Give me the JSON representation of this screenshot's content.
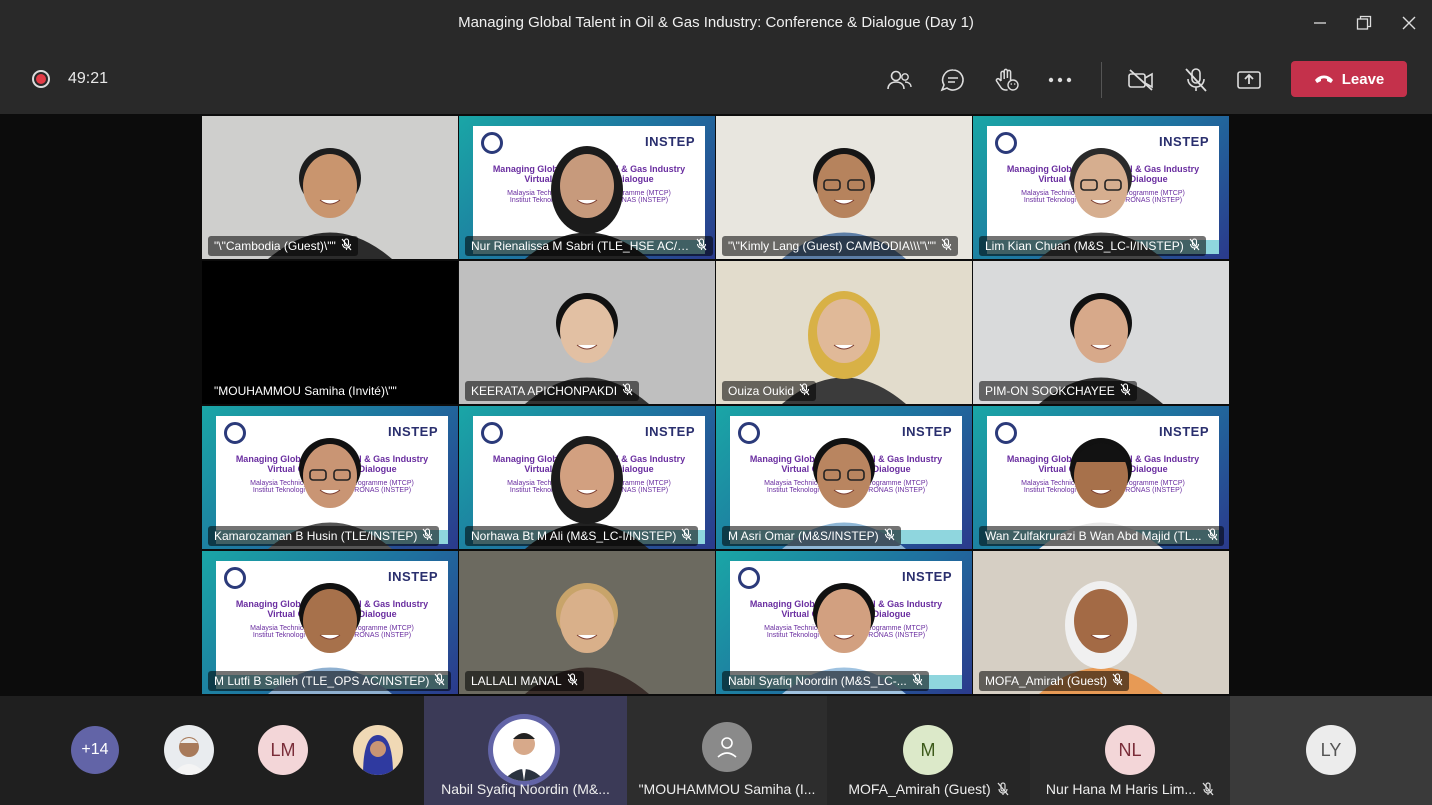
{
  "window": {
    "title": "Managing Global Talent in Oil & Gas Industry: Conference & Dialogue (Day 1)"
  },
  "toolbar": {
    "timer": "49:21",
    "leave_label": "Leave"
  },
  "slide": {
    "brand": "INSTEP",
    "line1": "Managing Global Talent in Oil & Gas Industry",
    "line1b": "Virtual Conference & Dialogue",
    "line2": "Malaysia Technical Cooperation Programme (MTCP)",
    "line2b": "Institut Teknologi Petroleum PETRONAS (INSTEP)"
  },
  "tiles": [
    {
      "name": "\"\\\"Cambodia (Guest)\\\"\""
    },
    {
      "name": "Nur Rienalissa M Sabri (TLE_HSE AC/IN..."
    },
    {
      "name": "\"\\\"Kimly Lang (Guest) CAMBODIA\\\\\\\"\\\"\""
    },
    {
      "name": "Lim Kian Chuan (M&S_LC-I/INSTEP)"
    },
    {
      "name": "\"MOUHAMMOU Samiha (Invité)\\\"\""
    },
    {
      "name": "KEERATA APICHONPAKDI"
    },
    {
      "name": "Ouiza Oukid"
    },
    {
      "name": "PIM-ON SOOKCHAYEE"
    },
    {
      "name": "Kamarozaman B Husin (TLE/INSTEP)"
    },
    {
      "name": "Norhawa Bt M Ali (M&S_LC-I/INSTEP)"
    },
    {
      "name": "M Asri Omar (M&S/INSTEP)"
    },
    {
      "name": "Wan Zulfakrurazi B Wan Abd Majid (TL..."
    },
    {
      "name": "M Lutfi B Salleh (TLE_OPS AC/INSTEP)"
    },
    {
      "name": "LALLALI MANAL"
    },
    {
      "name": "Nabil Syafiq Noordin (M&S_LC-..."
    },
    {
      "name": "MOFA_Amirah (Guest)"
    }
  ],
  "bottom": {
    "overflow": "+14",
    "avatar_lm": "LM",
    "panels": [
      {
        "label": "Nabil Syafiq Noordin (M&..."
      },
      {
        "label": "\"MOUHAMMOU Samiha (I..."
      },
      {
        "initials": "M",
        "label": "MOFA_Amirah (Guest)"
      },
      {
        "initials": "NL",
        "label": "Nur Hana M Haris Lim..."
      },
      {
        "initials": "LY",
        "label": ""
      }
    ]
  },
  "colors": {
    "leave": "#c4314b",
    "accent": "#6264a7",
    "record": "#e33c47"
  }
}
